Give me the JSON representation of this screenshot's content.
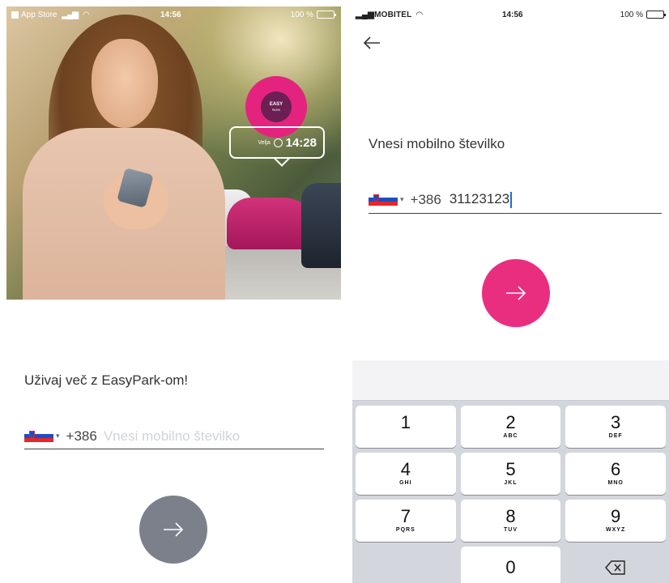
{
  "left_screen": {
    "status_bar": {
      "back_app": "App Store",
      "time": "14:56",
      "battery": "100 %",
      "battery_level": 1.0
    },
    "hero": {
      "badge_line1": "EASY",
      "badge_line2": "PARK",
      "bubble_small": "Velja",
      "bubble_time": "14:28"
    },
    "title": "Uživaj več z EasyPark-om!",
    "country_code": "+386",
    "phone_placeholder": "Vnesi mobilno številko",
    "phone_value": "",
    "next_icon": "arrow-right-icon"
  },
  "right_screen": {
    "status_bar": {
      "carrier": "MOBITEL",
      "time": "14:56",
      "battery": "100 %",
      "battery_level": 1.0
    },
    "back_icon": "arrow-left-icon",
    "title": "Vnesi mobilno številko",
    "country_code": "+386",
    "phone_value": "31123123",
    "next_icon": "arrow-right-icon",
    "accent_color": "#ea2e7f"
  },
  "keyboard": {
    "keys": [
      {
        "digit": "1",
        "letters": ""
      },
      {
        "digit": "2",
        "letters": "ABC"
      },
      {
        "digit": "3",
        "letters": "DEF"
      },
      {
        "digit": "4",
        "letters": "GHI"
      },
      {
        "digit": "5",
        "letters": "JKL"
      },
      {
        "digit": "6",
        "letters": "MNO"
      },
      {
        "digit": "7",
        "letters": "PQRS"
      },
      {
        "digit": "8",
        "letters": "TUV"
      },
      {
        "digit": "9",
        "letters": "WXYZ"
      }
    ],
    "zero": "0",
    "delete_icon": "backspace-icon"
  }
}
